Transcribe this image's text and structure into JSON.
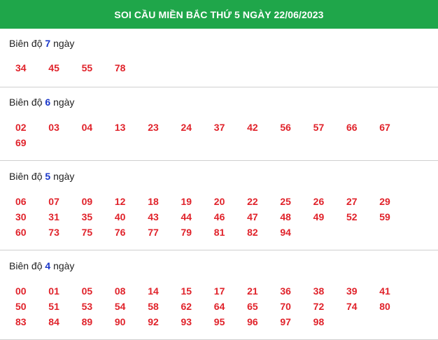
{
  "header": {
    "title": "SOI CẦU MIỀN BẮC THỨ 5 NGÀY 22/06/2023"
  },
  "sections": [
    {
      "prefix": "Biên độ",
      "number": "7",
      "suffix": "ngày",
      "values": [
        "34",
        "45",
        "55",
        "78"
      ]
    },
    {
      "prefix": "Biên độ",
      "number": "6",
      "suffix": "ngày",
      "values": [
        "02",
        "03",
        "04",
        "13",
        "23",
        "24",
        "37",
        "42",
        "56",
        "57",
        "66",
        "67",
        "69"
      ]
    },
    {
      "prefix": "Biên độ",
      "number": "5",
      "suffix": "ngày",
      "values": [
        "06",
        "07",
        "09",
        "12",
        "18",
        "19",
        "20",
        "22",
        "25",
        "26",
        "27",
        "29",
        "30",
        "31",
        "35",
        "40",
        "43",
        "44",
        "46",
        "47",
        "48",
        "49",
        "52",
        "59",
        "60",
        "73",
        "75",
        "76",
        "77",
        "79",
        "81",
        "82",
        "94"
      ]
    },
    {
      "prefix": "Biên độ",
      "number": "4",
      "suffix": "ngày",
      "values": [
        "00",
        "01",
        "05",
        "08",
        "14",
        "15",
        "17",
        "21",
        "36",
        "38",
        "39",
        "41",
        "50",
        "51",
        "53",
        "54",
        "58",
        "62",
        "64",
        "65",
        "70",
        "72",
        "74",
        "80",
        "83",
        "84",
        "89",
        "90",
        "92",
        "93",
        "95",
        "96",
        "97",
        "98"
      ]
    }
  ],
  "colors": {
    "header_bg": "#1fa64a",
    "value_red": "#e0222a",
    "number_blue": "#1a37c9"
  }
}
